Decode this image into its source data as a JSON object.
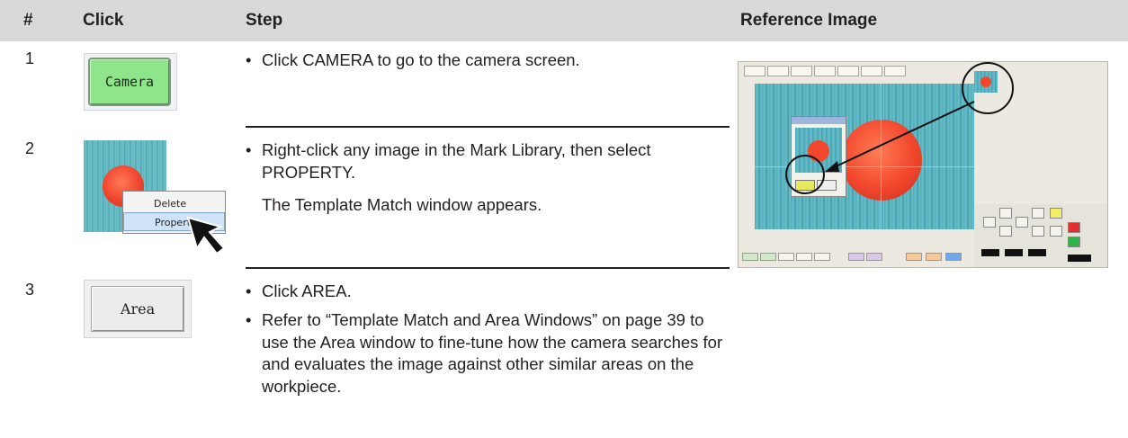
{
  "header": {
    "num": "#",
    "click": "Click",
    "step": "Step",
    "reference": "Reference Image"
  },
  "rows": [
    {
      "num": "1",
      "button_label": "Camera",
      "bullets": [
        "Click CAMERA to go to the camera screen."
      ]
    },
    {
      "num": "2",
      "menu_items": [
        "Delete",
        "Property"
      ],
      "bullets": [
        "Right-click any image in the Mark Library, then select PROPERTY."
      ],
      "note": "The Template Match window appears."
    },
    {
      "num": "3",
      "button_label": "Area",
      "bullets": [
        "Click AREA.",
        "Refer to “Template Match and Area Windows” on page 39 to use the Area window to fine-tune how the camera searches for and evaluates the image against other similar areas on the workpiece."
      ]
    }
  ],
  "colors": {
    "header_bg": "#d9d9d9",
    "camera_button": "#8ee58a",
    "mark_red": "#f0452c",
    "mark_cyan": "#5ab2bd"
  }
}
